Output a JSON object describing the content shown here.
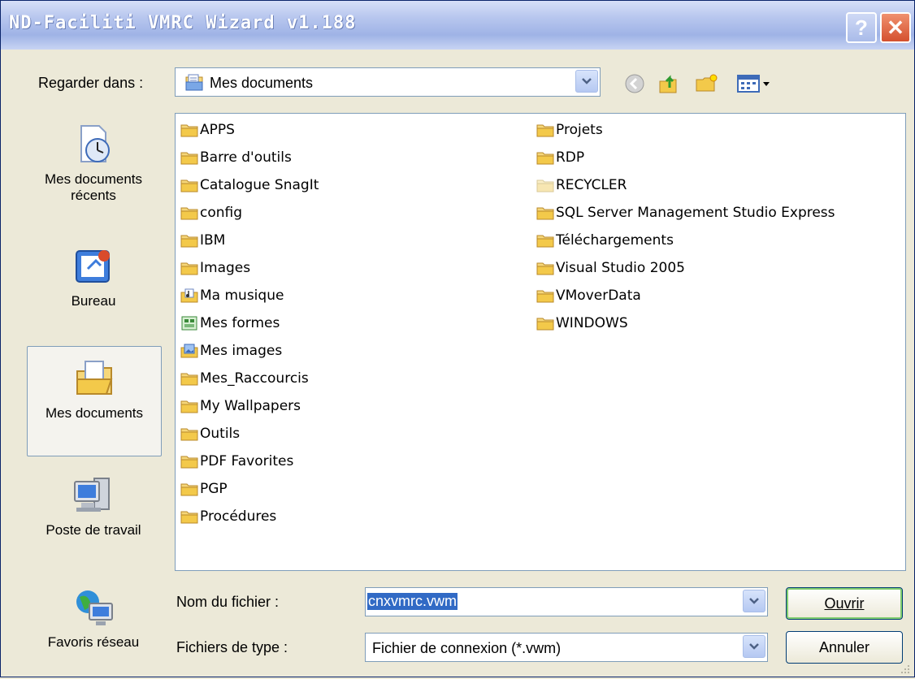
{
  "window": {
    "title": "ND-Faciliti VMRC Wizard v1.188",
    "help_label": "?",
    "close_label": "✕"
  },
  "look_in": {
    "label": "Regarder dans :",
    "underline_char": "d",
    "value": "Mes documents"
  },
  "toolbar": {
    "icons": [
      "back-icon",
      "up-folder-icon",
      "new-folder-icon",
      "view-menu-icon"
    ]
  },
  "places": [
    {
      "label": "Mes documents récents",
      "icon": "recent-documents-icon"
    },
    {
      "label": "Bureau",
      "icon": "desktop-icon"
    },
    {
      "label": "Mes documents",
      "icon": "my-documents-icon",
      "selected": true
    },
    {
      "label": "Poste de travail",
      "icon": "my-computer-icon"
    },
    {
      "label": "Favoris réseau",
      "icon": "network-places-icon"
    }
  ],
  "files": {
    "col1": [
      {
        "name": "APPS",
        "icon": "folder-icon"
      },
      {
        "name": "Barre d'outils",
        "icon": "folder-icon"
      },
      {
        "name": "Catalogue SnagIt",
        "icon": "folder-icon"
      },
      {
        "name": "config",
        "icon": "folder-icon"
      },
      {
        "name": "IBM",
        "icon": "folder-icon"
      },
      {
        "name": "Images",
        "icon": "folder-icon"
      },
      {
        "name": "Ma musique",
        "icon": "music-folder-icon"
      },
      {
        "name": "Mes formes",
        "icon": "shapes-folder-icon"
      },
      {
        "name": "Mes images",
        "icon": "pictures-folder-icon"
      },
      {
        "name": "Mes_Raccourcis",
        "icon": "folder-icon"
      },
      {
        "name": "My Wallpapers",
        "icon": "folder-icon"
      },
      {
        "name": "Outils",
        "icon": "folder-icon"
      },
      {
        "name": "PDF Favorites",
        "icon": "folder-icon"
      },
      {
        "name": "PGP",
        "icon": "folder-icon"
      },
      {
        "name": "Procédures",
        "icon": "folder-icon"
      }
    ],
    "col2": [
      {
        "name": "Projets",
        "icon": "folder-icon"
      },
      {
        "name": "RDP",
        "icon": "folder-icon"
      },
      {
        "name": "RECYCLER",
        "icon": "hidden-folder-icon"
      },
      {
        "name": "SQL Server Management Studio Express",
        "icon": "folder-icon"
      },
      {
        "name": "Téléchargements",
        "icon": "folder-icon"
      },
      {
        "name": "Visual Studio 2005",
        "icon": "folder-icon"
      },
      {
        "name": "VMoverData",
        "icon": "folder-icon"
      },
      {
        "name": "WINDOWS",
        "icon": "folder-icon"
      }
    ]
  },
  "file_name": {
    "label": "Nom du fichier :",
    "underline_char": "N",
    "value": "cnxvmrc.vwm"
  },
  "file_type": {
    "label": "Fichiers de type :",
    "underline_char": "t",
    "value": "Fichier de connexion (*.vwm)"
  },
  "buttons": {
    "open": "Ouvrir",
    "cancel": "Annuler"
  },
  "colors": {
    "selection": "#316ac5",
    "face": "#ece9d8",
    "title_gradient_start": "#d6dff7"
  }
}
